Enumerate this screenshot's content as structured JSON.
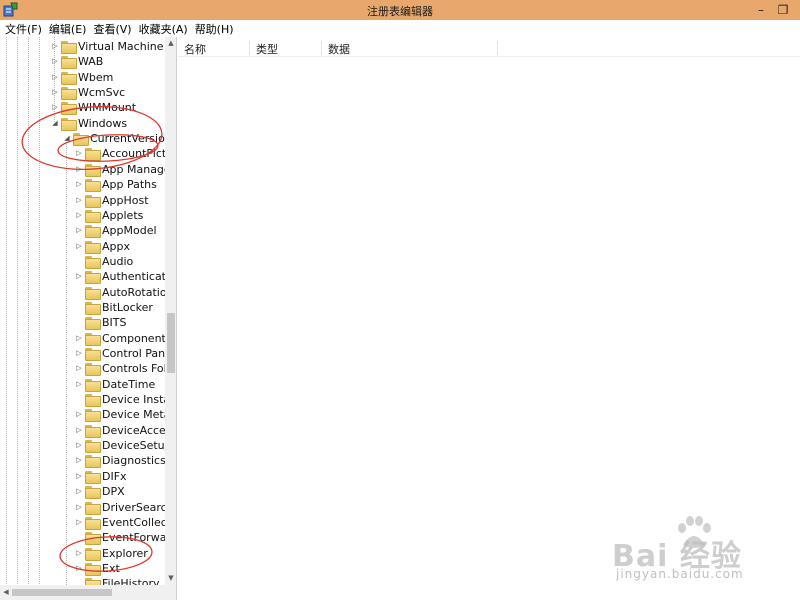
{
  "window": {
    "title": "注册表编辑器",
    "minimize_glyph": "–",
    "restore_glyph": "❐",
    "titlebar_color": "#e8a86c"
  },
  "menu": {
    "items": [
      "文件(F)",
      "编辑(E)",
      "查看(V)",
      "收藏夹(A)",
      "帮助(H)"
    ]
  },
  "tree": {
    "nodes": [
      {
        "label": "Virtual Machine",
        "expander": "▷"
      },
      {
        "label": "WAB",
        "expander": "▷"
      },
      {
        "label": "Wbem",
        "expander": "▷"
      },
      {
        "label": "WcmSvc",
        "expander": "▷"
      },
      {
        "label": "WIMMount",
        "expander": "▷"
      },
      {
        "label": "Windows",
        "expander": "◢"
      },
      {
        "label": "CurrentVersion",
        "expander": "◢"
      },
      {
        "label": "AccountPicture",
        "expander": "▷"
      },
      {
        "label": "App Management",
        "expander": "▷"
      },
      {
        "label": "App Paths",
        "expander": "▷"
      },
      {
        "label": "AppHost",
        "expander": "▷"
      },
      {
        "label": "Applets",
        "expander": "▷"
      },
      {
        "label": "AppModel",
        "expander": "▷"
      },
      {
        "label": "Appx",
        "expander": "▷"
      },
      {
        "label": "Audio",
        "expander": ""
      },
      {
        "label": "Authentication",
        "expander": "▷"
      },
      {
        "label": "AutoRotation",
        "expander": ""
      },
      {
        "label": "BitLocker",
        "expander": ""
      },
      {
        "label": "BITS",
        "expander": ""
      },
      {
        "label": "Component Based S",
        "expander": "▷"
      },
      {
        "label": "Control Panel",
        "expander": "▷"
      },
      {
        "label": "Controls Folder",
        "expander": "▷"
      },
      {
        "label": "DateTime",
        "expander": "▷"
      },
      {
        "label": "Device Installer",
        "expander": ""
      },
      {
        "label": "Device Metadata",
        "expander": "▷"
      },
      {
        "label": "DeviceAccess",
        "expander": "▷"
      },
      {
        "label": "DeviceSetup",
        "expander": "▷"
      },
      {
        "label": "Diagnostics",
        "expander": "▷"
      },
      {
        "label": "DIFx",
        "expander": "▷"
      },
      {
        "label": "DPX",
        "expander": "▷"
      },
      {
        "label": "DriverSearching",
        "expander": "▷"
      },
      {
        "label": "EventCollector",
        "expander": "▷"
      },
      {
        "label": "EventForwarding",
        "expander": ""
      },
      {
        "label": "Explorer",
        "expander": "▷"
      },
      {
        "label": "Ext",
        "expander": "▷"
      },
      {
        "label": "FileHistory",
        "expander": ""
      }
    ]
  },
  "list": {
    "columns": [
      "名称",
      "类型",
      "数据"
    ]
  },
  "scroll": {
    "up_glyph": "▲",
    "down_glyph": "▼",
    "left_glyph": "◀"
  },
  "watermark": {
    "logo": "Bai 经验",
    "url": "jingyan.baidu.com"
  },
  "colors": {
    "annotation": "#e0352b",
    "folder": "#e8c559"
  }
}
